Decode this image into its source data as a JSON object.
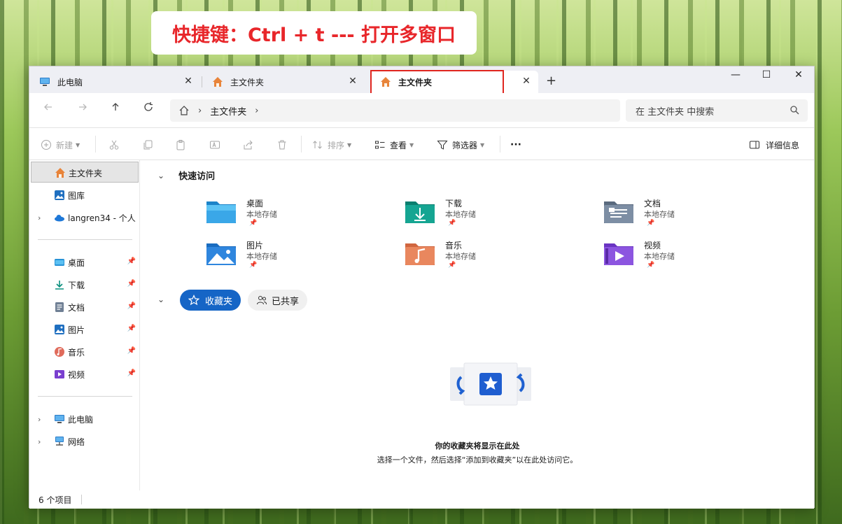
{
  "banner": {
    "text": "快捷键：Ctrl + t   --- 打开多窗口"
  },
  "tabs": [
    {
      "label": "此电脑",
      "icon": "computer-icon",
      "active": false
    },
    {
      "label": "主文件夹",
      "icon": "home-icon",
      "active": false
    },
    {
      "label": "主文件夹",
      "icon": "home-icon",
      "active": true
    }
  ],
  "new_tab_label": "+",
  "window_controls": {
    "minimize": "—",
    "maximize": "☐",
    "close": "✕"
  },
  "address": {
    "crumb": "主文件夹",
    "separator": "›"
  },
  "search": {
    "placeholder": "在 主文件夹 中搜索"
  },
  "toolbar": {
    "new_label": "新建",
    "sort_label": "排序",
    "view_label": "查看",
    "filter_label": "筛选器",
    "more_label": "···",
    "details_label": "详细信息"
  },
  "sidebar": {
    "top": [
      {
        "label": "主文件夹",
        "icon": "home-icon",
        "selected": true
      },
      {
        "label": "图库",
        "icon": "gallery-icon"
      },
      {
        "label": "langren34 - 个人",
        "icon": "onedrive-icon",
        "expandable": true
      }
    ],
    "pinned": [
      {
        "label": "桌面",
        "icon": "desktop-folder-icon"
      },
      {
        "label": "下载",
        "icon": "download-icon"
      },
      {
        "label": "文档",
        "icon": "documents-icon"
      },
      {
        "label": "图片",
        "icon": "pictures-icon"
      },
      {
        "label": "音乐",
        "icon": "music-icon"
      },
      {
        "label": "视频",
        "icon": "videos-icon"
      }
    ],
    "bottom": [
      {
        "label": "此电脑",
        "icon": "computer-icon"
      },
      {
        "label": "网络",
        "icon": "network-icon"
      }
    ]
  },
  "quick_access": {
    "title": "快速访问",
    "items": [
      {
        "name": "桌面",
        "sub": "本地存储"
      },
      {
        "name": "下载",
        "sub": "本地存储"
      },
      {
        "name": "文档",
        "sub": "本地存储"
      },
      {
        "name": "图片",
        "sub": "本地存储"
      },
      {
        "name": "音乐",
        "sub": "本地存储"
      },
      {
        "name": "视频",
        "sub": "本地存储"
      }
    ]
  },
  "favorites": {
    "tab_favorites": "收藏夹",
    "tab_shared": "已共享",
    "empty_title": "你的收藏夹将显示在此处",
    "empty_sub": "选择一个文件，然后选择“添加到收藏夹”以在此处访问它。"
  },
  "status": {
    "count": "6 个项目"
  },
  "colors": {
    "accent": "#1565c6",
    "highlight_box": "#e0261f",
    "banner_text": "#e8262a"
  }
}
